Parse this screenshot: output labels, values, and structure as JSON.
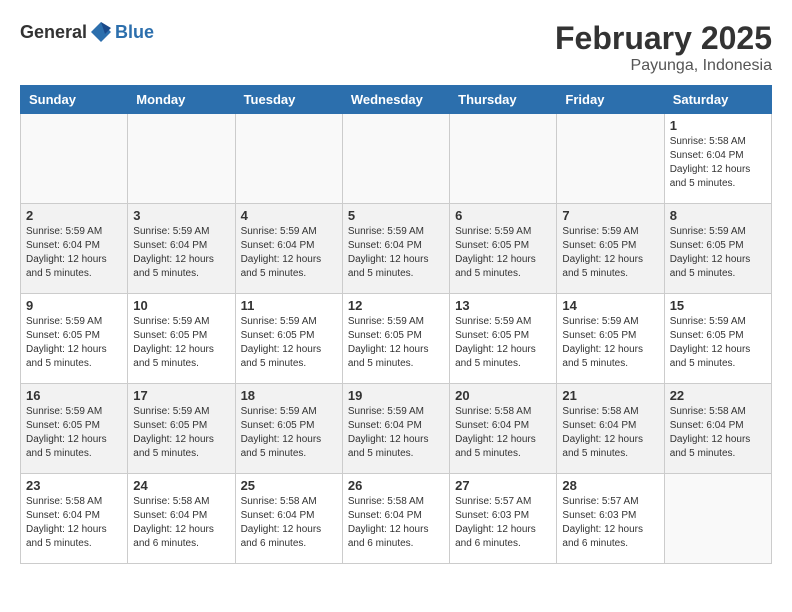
{
  "header": {
    "logo_general": "General",
    "logo_blue": "Blue",
    "month": "February 2025",
    "location": "Payunga, Indonesia"
  },
  "weekdays": [
    "Sunday",
    "Monday",
    "Tuesday",
    "Wednesday",
    "Thursday",
    "Friday",
    "Saturday"
  ],
  "weeks": [
    [
      {
        "day": "",
        "info": ""
      },
      {
        "day": "",
        "info": ""
      },
      {
        "day": "",
        "info": ""
      },
      {
        "day": "",
        "info": ""
      },
      {
        "day": "",
        "info": ""
      },
      {
        "day": "",
        "info": ""
      },
      {
        "day": "1",
        "info": "Sunrise: 5:58 AM\nSunset: 6:04 PM\nDaylight: 12 hours\nand 5 minutes."
      }
    ],
    [
      {
        "day": "2",
        "info": "Sunrise: 5:59 AM\nSunset: 6:04 PM\nDaylight: 12 hours\nand 5 minutes."
      },
      {
        "day": "3",
        "info": "Sunrise: 5:59 AM\nSunset: 6:04 PM\nDaylight: 12 hours\nand 5 minutes."
      },
      {
        "day": "4",
        "info": "Sunrise: 5:59 AM\nSunset: 6:04 PM\nDaylight: 12 hours\nand 5 minutes."
      },
      {
        "day": "5",
        "info": "Sunrise: 5:59 AM\nSunset: 6:04 PM\nDaylight: 12 hours\nand 5 minutes."
      },
      {
        "day": "6",
        "info": "Sunrise: 5:59 AM\nSunset: 6:05 PM\nDaylight: 12 hours\nand 5 minutes."
      },
      {
        "day": "7",
        "info": "Sunrise: 5:59 AM\nSunset: 6:05 PM\nDaylight: 12 hours\nand 5 minutes."
      },
      {
        "day": "8",
        "info": "Sunrise: 5:59 AM\nSunset: 6:05 PM\nDaylight: 12 hours\nand 5 minutes."
      }
    ],
    [
      {
        "day": "9",
        "info": "Sunrise: 5:59 AM\nSunset: 6:05 PM\nDaylight: 12 hours\nand 5 minutes."
      },
      {
        "day": "10",
        "info": "Sunrise: 5:59 AM\nSunset: 6:05 PM\nDaylight: 12 hours\nand 5 minutes."
      },
      {
        "day": "11",
        "info": "Sunrise: 5:59 AM\nSunset: 6:05 PM\nDaylight: 12 hours\nand 5 minutes."
      },
      {
        "day": "12",
        "info": "Sunrise: 5:59 AM\nSunset: 6:05 PM\nDaylight: 12 hours\nand 5 minutes."
      },
      {
        "day": "13",
        "info": "Sunrise: 5:59 AM\nSunset: 6:05 PM\nDaylight: 12 hours\nand 5 minutes."
      },
      {
        "day": "14",
        "info": "Sunrise: 5:59 AM\nSunset: 6:05 PM\nDaylight: 12 hours\nand 5 minutes."
      },
      {
        "day": "15",
        "info": "Sunrise: 5:59 AM\nSunset: 6:05 PM\nDaylight: 12 hours\nand 5 minutes."
      }
    ],
    [
      {
        "day": "16",
        "info": "Sunrise: 5:59 AM\nSunset: 6:05 PM\nDaylight: 12 hours\nand 5 minutes."
      },
      {
        "day": "17",
        "info": "Sunrise: 5:59 AM\nSunset: 6:05 PM\nDaylight: 12 hours\nand 5 minutes."
      },
      {
        "day": "18",
        "info": "Sunrise: 5:59 AM\nSunset: 6:05 PM\nDaylight: 12 hours\nand 5 minutes."
      },
      {
        "day": "19",
        "info": "Sunrise: 5:59 AM\nSunset: 6:04 PM\nDaylight: 12 hours\nand 5 minutes."
      },
      {
        "day": "20",
        "info": "Sunrise: 5:58 AM\nSunset: 6:04 PM\nDaylight: 12 hours\nand 5 minutes."
      },
      {
        "day": "21",
        "info": "Sunrise: 5:58 AM\nSunset: 6:04 PM\nDaylight: 12 hours\nand 5 minutes."
      },
      {
        "day": "22",
        "info": "Sunrise: 5:58 AM\nSunset: 6:04 PM\nDaylight: 12 hours\nand 5 minutes."
      }
    ],
    [
      {
        "day": "23",
        "info": "Sunrise: 5:58 AM\nSunset: 6:04 PM\nDaylight: 12 hours\nand 5 minutes."
      },
      {
        "day": "24",
        "info": "Sunrise: 5:58 AM\nSunset: 6:04 PM\nDaylight: 12 hours\nand 6 minutes."
      },
      {
        "day": "25",
        "info": "Sunrise: 5:58 AM\nSunset: 6:04 PM\nDaylight: 12 hours\nand 6 minutes."
      },
      {
        "day": "26",
        "info": "Sunrise: 5:58 AM\nSunset: 6:04 PM\nDaylight: 12 hours\nand 6 minutes."
      },
      {
        "day": "27",
        "info": "Sunrise: 5:57 AM\nSunset: 6:03 PM\nDaylight: 12 hours\nand 6 minutes."
      },
      {
        "day": "28",
        "info": "Sunrise: 5:57 AM\nSunset: 6:03 PM\nDaylight: 12 hours\nand 6 minutes."
      },
      {
        "day": "",
        "info": ""
      }
    ]
  ]
}
